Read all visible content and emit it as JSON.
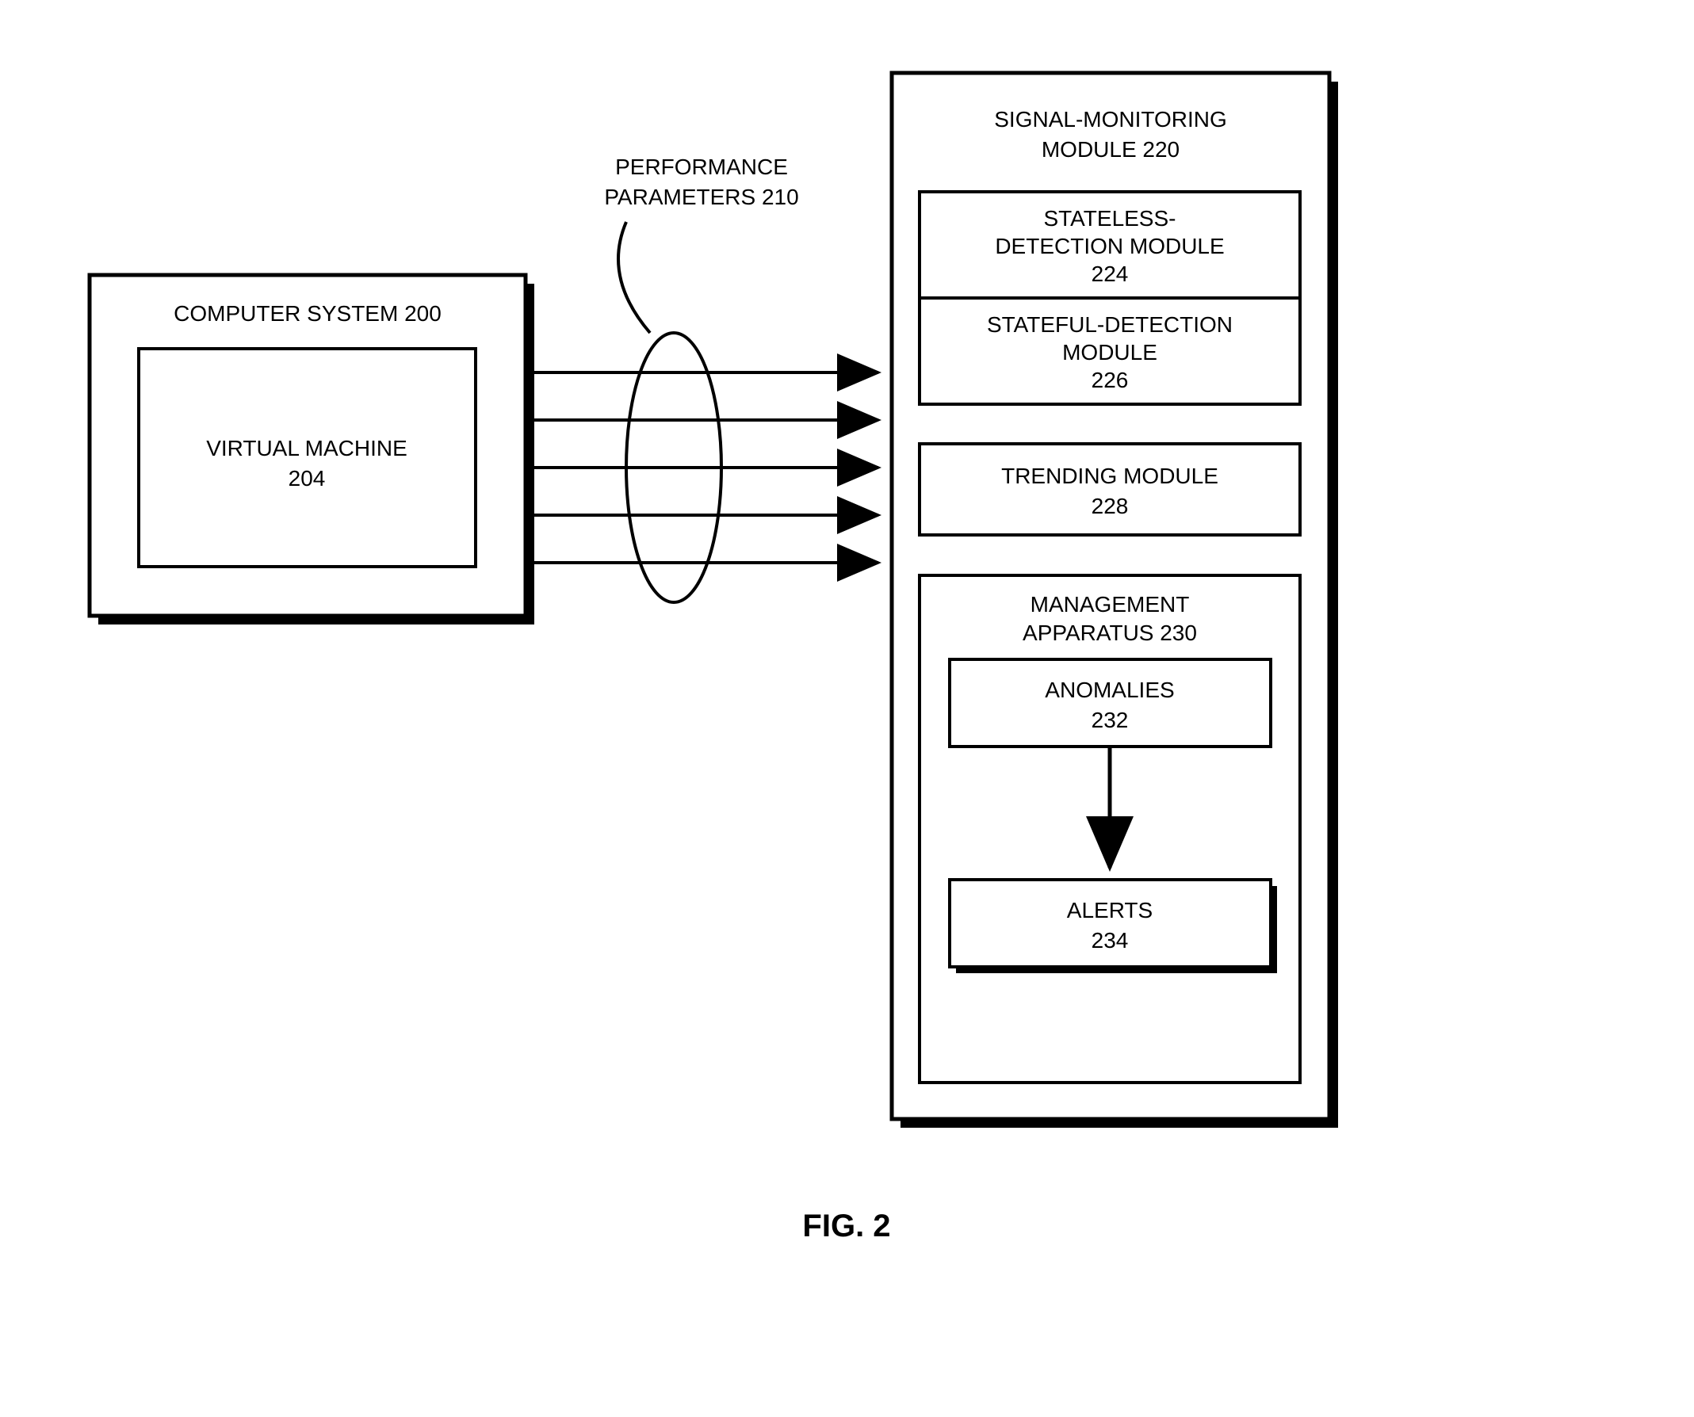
{
  "figure_label": "FIG. 2",
  "performance": {
    "line1": "PERFORMANCE",
    "line2": "PARAMETERS 210"
  },
  "computer_system": {
    "title": "COMPUTER SYSTEM 200",
    "vm": {
      "line1": "VIRTUAL MACHINE",
      "line2": "204"
    }
  },
  "monitor": {
    "title_line1": "SIGNAL-MONITORING",
    "title_line2": "MODULE 220",
    "stateless": {
      "line1": "STATELESS-",
      "line2": "DETECTION MODULE",
      "line3": "224"
    },
    "stateful": {
      "line1": "STATEFUL-DETECTION",
      "line2": "MODULE",
      "line3": "226"
    },
    "trending": {
      "line1": "TRENDING MODULE",
      "line2": "228"
    },
    "management": {
      "title_line1": "MANAGEMENT",
      "title_line2": "APPARATUS 230",
      "anomalies": {
        "line1": "ANOMALIES",
        "line2": "232"
      },
      "alerts": {
        "line1": "ALERTS",
        "line2": "234"
      }
    }
  }
}
